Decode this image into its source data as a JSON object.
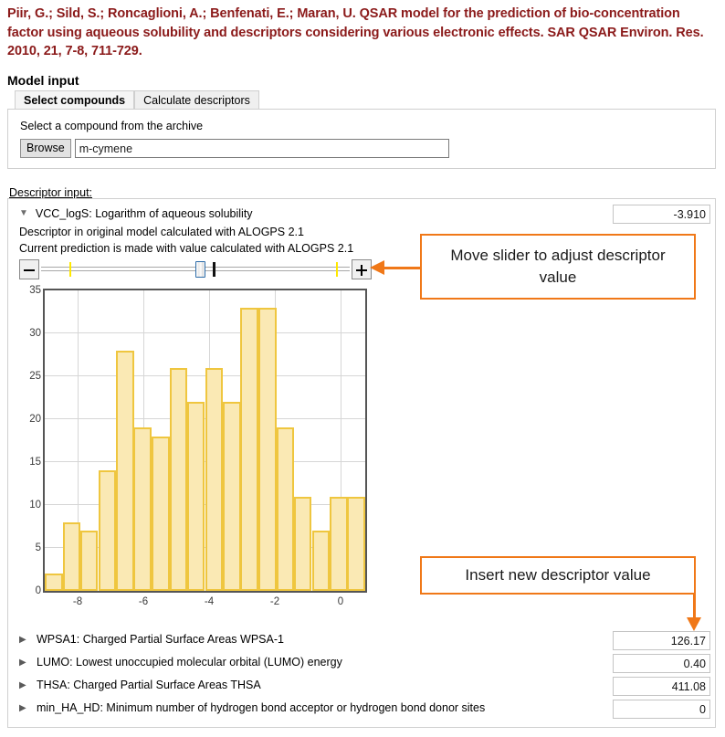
{
  "citation": "Piir, G.; Sild, S.; Roncaglioni, A.; Benfenati, E.; Maran, U. QSAR model for the prediction of bio-concentration factor using aqueous solubility and descriptors considering various electronic effects. SAR QSAR Environ. Res. 2010, 21, 7-8, 711-729.",
  "model_input": {
    "heading": "Model input",
    "tabs": [
      {
        "label": "Select compounds",
        "active": true
      },
      {
        "label": "Calculate descriptors",
        "active": false
      }
    ],
    "select_panel": {
      "label": "Select a compound from the archive",
      "browse_label": "Browse",
      "compound_value": "m-cymene",
      "compound_placeholder": ""
    }
  },
  "descriptor_input": {
    "section_label": "Descriptor input:",
    "expanded": {
      "caret": "▼",
      "label": "VCC_logS: Logarithm of aqueous solubility",
      "note1": "Descriptor in original model calculated with ALOGPS 2.1",
      "note2": "Current prediction is made with value calculated with ALOGPS 2.1",
      "value": "-3.910",
      "slider": {
        "minus_label": "−",
        "plus_label": "+"
      }
    },
    "rows": [
      {
        "caret": "▶",
        "label": "WPSA1: Charged Partial Surface Areas WPSA-1",
        "value": "126.17"
      },
      {
        "caret": "▶",
        "label": "LUMO: Lowest unoccupied molecular orbital (LUMO) energy",
        "value": "0.40"
      },
      {
        "caret": "▶",
        "label": "THSA: Charged Partial Surface Areas THSA",
        "value": "411.08"
      },
      {
        "caret": "▶",
        "label": "min_HA_HD: Minimum number of hydrogen bond acceptor or hydrogen bond donor sites",
        "value": "0"
      }
    ]
  },
  "callouts": [
    {
      "text": "Move slider to adjust descriptor value"
    },
    {
      "text": "Insert new descriptor value"
    }
  ],
  "colors": {
    "citation": "#8b1a1a",
    "callout_accent": "#f07818",
    "bar_fill": "#fae9b4",
    "bar_border": "#efc63f",
    "slider_marker_yellow": "#ffe800",
    "slider_marker_black": "#111111"
  },
  "chart_data": {
    "type": "bar",
    "title": "",
    "xlabel": "",
    "ylabel": "",
    "xlim": [
      -9.0,
      0.75
    ],
    "ylim": [
      0,
      35
    ],
    "xticks": [
      -8,
      -6,
      -4,
      -2,
      0
    ],
    "yticks": [
      0,
      5,
      10,
      15,
      20,
      25,
      30,
      35
    ],
    "grid": true,
    "bin_width": 0.5417,
    "bin_starts": [
      -9.0,
      -8.458,
      -7.917,
      -7.375,
      -6.833,
      -6.292,
      -5.75,
      -5.208,
      -4.667,
      -4.125,
      -3.583,
      -3.042,
      -2.5,
      -1.958,
      -1.417,
      -0.875,
      -0.333,
      0.208
    ],
    "categories": [
      "-9.0",
      "-8.5",
      "-7.9",
      "-7.4",
      "-6.8",
      "-6.3",
      "-5.8",
      "-5.2",
      "-4.7",
      "-4.1",
      "-3.6",
      "-3.0",
      "-2.5",
      "-2.0",
      "-1.4",
      "-0.9",
      "-0.3",
      "0.2"
    ],
    "values": [
      2,
      8,
      7,
      14,
      28,
      19,
      18,
      26,
      22,
      26,
      22,
      33,
      33,
      19,
      11,
      7,
      11,
      11
    ]
  }
}
